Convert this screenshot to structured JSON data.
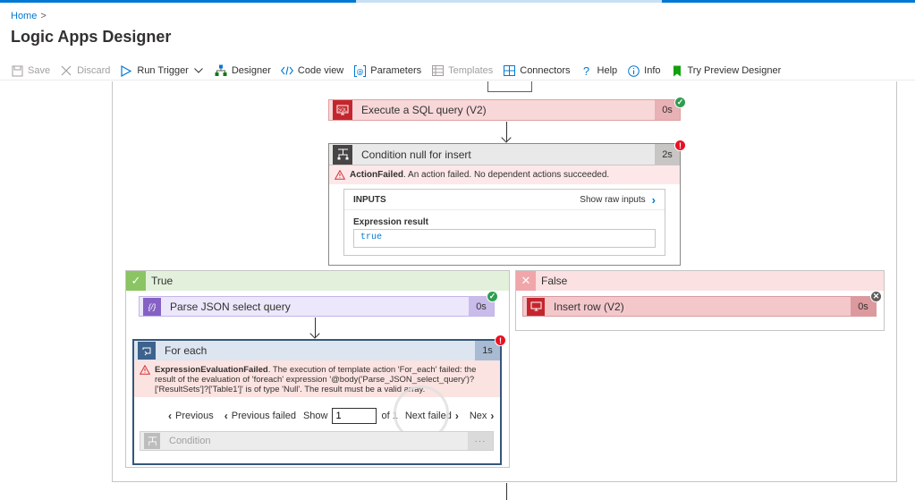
{
  "breadcrumb": {
    "home": "Home",
    "separator": ">"
  },
  "page": {
    "title": "Logic Apps Designer",
    "more": "···"
  },
  "toolbar": {
    "save": "Save",
    "discard": "Discard",
    "run_trigger": "Run Trigger",
    "designer": "Designer",
    "code_view": "Code view",
    "parameters": "Parameters",
    "templates": "Templates",
    "connectors": "Connectors",
    "help": "Help",
    "info": "Info",
    "try_preview": "Try Preview Designer"
  },
  "sql_action": {
    "label": "Execute a SQL query (V2)",
    "duration": "0s",
    "status": "succeeded"
  },
  "condition": {
    "label": "Condition null for insert",
    "duration": "2s",
    "status": "failed",
    "error_title": "ActionFailed",
    "error_text": ". An action failed. No dependent actions succeeded.",
    "inputs_title": "INPUTS",
    "show_raw": "Show raw inputs",
    "expression_label": "Expression result",
    "expression_value": "true"
  },
  "true_branch": {
    "label": "True",
    "parse_action": {
      "label": "Parse JSON select query",
      "duration": "0s",
      "status": "succeeded"
    },
    "foreach": {
      "label": "For each",
      "duration": "1s",
      "status": "failed",
      "error_title": "ExpressionEvaluationFailed",
      "error_text": ". The execution of template action 'For_each' failed: the result of the evaluation of 'foreach' expression '@body('Parse_JSON_select_query')?['ResultSets']?['Table1']' is of type 'Null'. The result must be a valid array.",
      "pager": {
        "previous": "Previous",
        "previous_failed": "Previous failed",
        "show": "Show",
        "page_value": "1",
        "of": "of 1",
        "next_failed": "Next failed",
        "next": "Nex"
      },
      "inner_condition": {
        "label": "Condition",
        "more": "···"
      }
    }
  },
  "false_branch": {
    "label": "False",
    "insert_action": {
      "label": "Insert row (V2)",
      "duration": "0s",
      "status": "skipped"
    }
  },
  "colors": {
    "accent": "#0078d4",
    "success": "#2e9e4f",
    "error": "#e81123",
    "sql_red": "#c4262e",
    "parse_purple": "#8661c5",
    "foreach_blue": "#3c628d"
  }
}
